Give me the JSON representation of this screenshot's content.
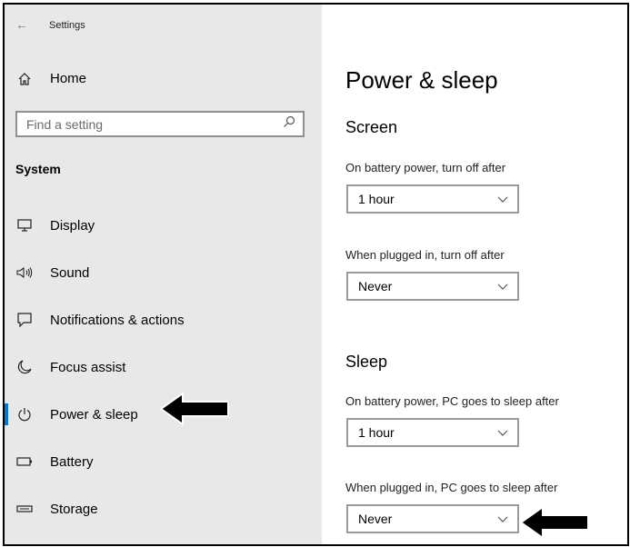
{
  "window": {
    "back_glyph": "←",
    "title": "Settings"
  },
  "sidebar": {
    "home_label": "Home",
    "search_placeholder": "Find a setting",
    "section_heading": "System",
    "items": [
      {
        "label": "Display"
      },
      {
        "label": "Sound"
      },
      {
        "label": "Notifications & actions"
      },
      {
        "label": "Focus assist"
      },
      {
        "label": "Power & sleep",
        "selected": true
      },
      {
        "label": "Battery"
      },
      {
        "label": "Storage"
      }
    ]
  },
  "main": {
    "title": "Power & sleep",
    "screen": {
      "heading": "Screen",
      "battery_label": "On battery power, turn off after",
      "battery_value": "1 hour",
      "plugged_label": "When plugged in, turn off after",
      "plugged_value": "Never"
    },
    "sleep": {
      "heading": "Sleep",
      "battery_label": "On battery power, PC goes to sleep after",
      "battery_value": "1 hour",
      "plugged_label": "When plugged in, PC goes to sleep after",
      "plugged_value": "Never"
    }
  },
  "colors": {
    "sidebar_bg": "#e8e8e8",
    "accent": "#0078d7",
    "annotation_arrow": "#000000"
  }
}
